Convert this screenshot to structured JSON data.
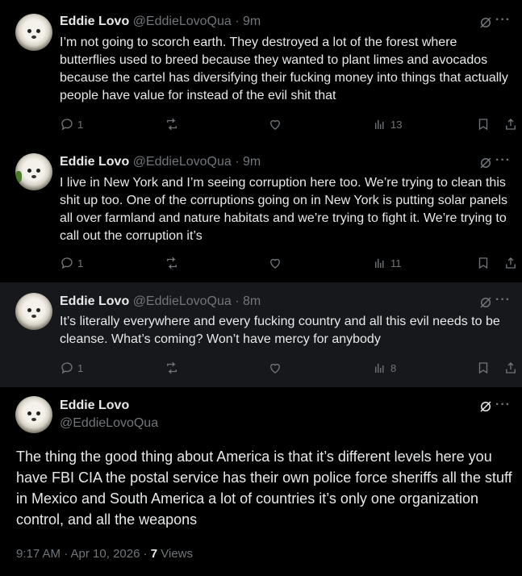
{
  "replies": [
    {
      "name": "Eddie Lovo",
      "handle": "@EddieLovoQua",
      "time": "· 9m",
      "text": "I’m not going to scorch earth. They destroyed a lot of the forest where butterflies used to breed because they wanted to plant limes and avocados because the cartel has diversifying their fucking money into things that actually people have value for instead of the evil shit that",
      "replies_count": "1",
      "views": "13"
    },
    {
      "name": "Eddie Lovo",
      "handle": "@EddieLovoQua",
      "time": "· 9m",
      "text": "I live in New York and I’m seeing corruption here too. We’re trying to clean this shit up too. One of the corruptions going on in New York is putting solar panels all over farmland and nature habitats and we’re trying to fight it. We’re trying to call out the corruption it’s",
      "replies_count": "1",
      "views": "11"
    },
    {
      "name": "Eddie Lovo",
      "handle": "@EddieLovoQua",
      "time": "· 8m",
      "text": "It’s literally everywhere and every fucking country and all this evil needs to be cleanse. What’s coming? Won’t have mercy for anybody",
      "replies_count": "1",
      "views": "8"
    }
  ],
  "main": {
    "name": "Eddie Lovo",
    "handle": "@EddieLovoQua",
    "text": "The thing the good thing about America is that it’s different levels here you have FBI CIA the postal service has their own police force sheriffs all the stuff in Mexico and South America a lot of countries it’s only one organization control, and all the weapons",
    "timestamp": "9:17 AM · Apr 10, 2026 · ",
    "views_count": "7",
    "views_label": " Views"
  },
  "more_glyph": "···",
  "colors": {
    "background": "#000000",
    "highlight": "#16181c",
    "text": "#e7e9ea",
    "muted": "#71767b"
  }
}
